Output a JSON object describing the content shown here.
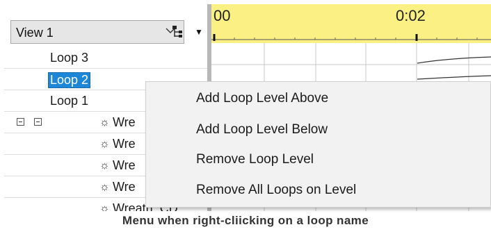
{
  "view_select": {
    "value": "View 1"
  },
  "ruler": {
    "label_start": "00",
    "label_mid": "0:02"
  },
  "tree": {
    "loops": [
      "Loop 3",
      "Loop 2",
      "Loop 1"
    ],
    "selected": "Loop 2",
    "wreath_rows": [
      "Wre",
      "Wre",
      "Wre",
      "Wre"
    ],
    "partial_row": "Wreath: CD"
  },
  "context_menu": {
    "items": [
      "Add Loop Level Above",
      "Add Loop Level Below",
      "Remove Loop Level",
      "Remove All Loops on Level"
    ]
  },
  "caption": "Menu when right-cliicking on a loop name",
  "colors": {
    "ruler_bg": "#fbf083",
    "selection": "#1e86d6",
    "menu_bg": "#f2f2f2"
  }
}
